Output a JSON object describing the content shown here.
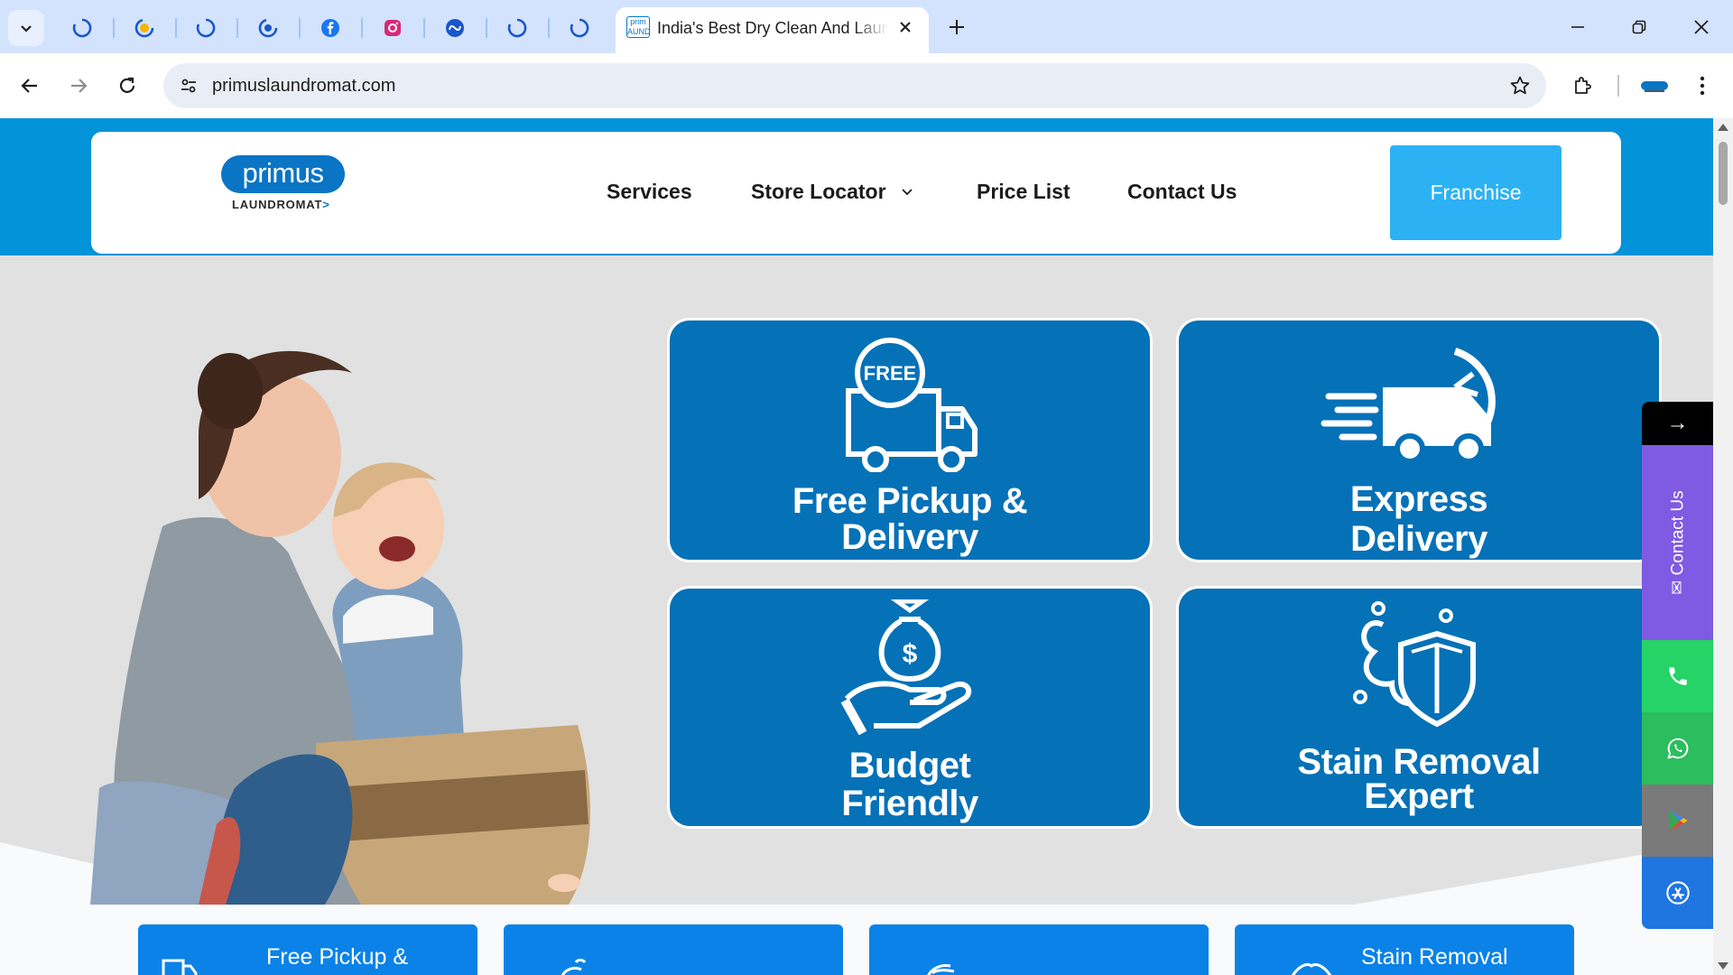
{
  "browser": {
    "active_tab_title": "India's Best Dry Clean And Laundry Services",
    "active_tab_favicon_text": "prim AUNDR",
    "url": "primuslaundromat.com"
  },
  "header": {
    "logo_main": "primus",
    "logo_sub": "LAUNDROMAT",
    "logo_arrow": ">",
    "menu": {
      "services": "Services",
      "store_locator": "Store Locator",
      "price_list": "Price List",
      "contact_us": "Contact Us"
    },
    "franchise_label": "Franchise"
  },
  "hero": {
    "cards": [
      {
        "line1": "Free Pickup &",
        "line2": "Delivery",
        "badge": "FREE"
      },
      {
        "line1": "Express",
        "line2": "Delivery"
      },
      {
        "line1": "Budget",
        "line2": "Friendly"
      },
      {
        "line1": "Stain Removal",
        "line2": "Expert"
      }
    ]
  },
  "bottom_cards": [
    {
      "label": "Free Pickup &"
    },
    {
      "label": ""
    },
    {
      "label": ""
    },
    {
      "label": "Stain Removal"
    }
  ],
  "side_widget": {
    "arrow": "→",
    "contact_label": "Contact Us"
  },
  "colors": {
    "brand_blue": "#0a74c5",
    "header_band": "#0393d9",
    "franchise": "#2db1f5",
    "card_blue": "#0571b7",
    "contact_purple": "#7e5be2",
    "phone_green": "#25d366",
    "bottom_card": "#0b82e8"
  }
}
